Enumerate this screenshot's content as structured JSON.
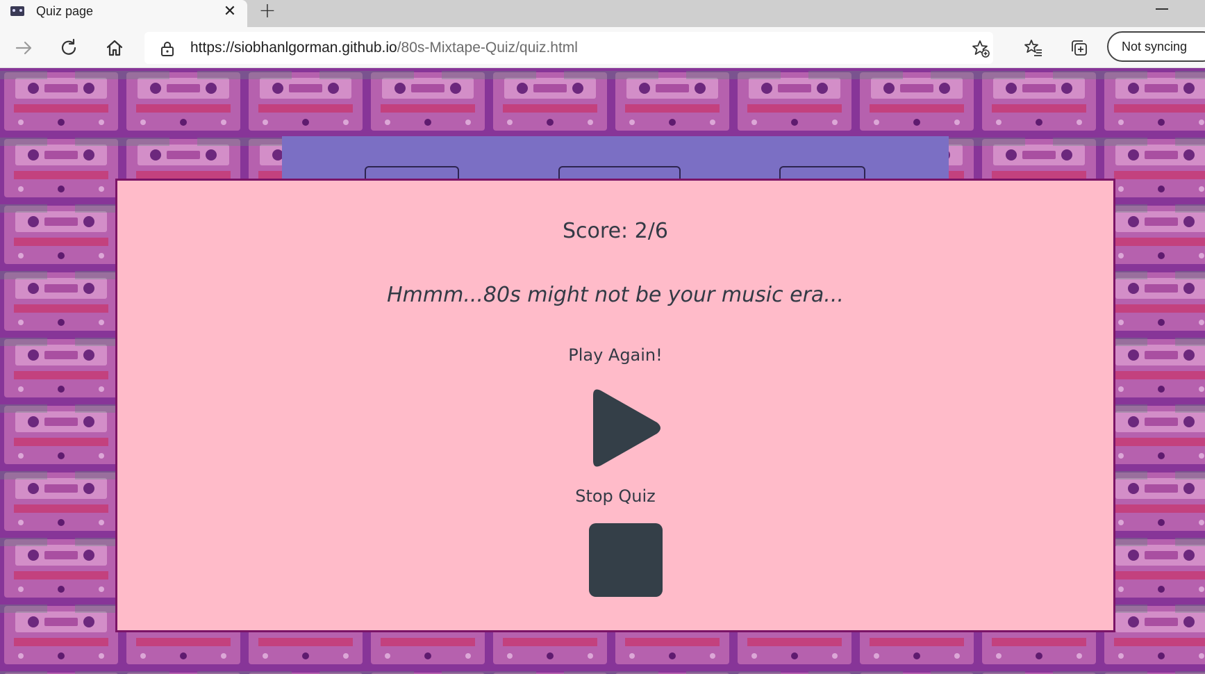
{
  "browser": {
    "tab_title": "Quiz page",
    "tab_close": "✕",
    "new_tab": "+",
    "url_host": "https://siobhanlgorman.github.io",
    "url_path": "/80s-Mixtape-Quiz/quiz.html",
    "sync_label": "Not syncing"
  },
  "quiz": {
    "score_text": "Score: 2/6",
    "result_message": "Hmmm...80s might not be your music era...",
    "play_again_label": "Play Again!",
    "stop_quiz_label": "Stop Quiz"
  },
  "colors": {
    "panel_background": "#ffbbc9",
    "panel_border": "#7b1466",
    "nav_background": "#7b6fc4",
    "icon_dark": "#343f48",
    "text_dark": "#333a45"
  },
  "icons": {
    "favicon": "cassette-icon",
    "close": "close-icon",
    "back": "back-arrow-icon",
    "reload": "reload-icon",
    "home": "home-icon",
    "lock": "lock-icon",
    "favorites_add": "star-add-icon",
    "favorites": "favorites-icon",
    "collections": "collections-icon",
    "play": "play-icon",
    "stop": "stop-icon"
  }
}
